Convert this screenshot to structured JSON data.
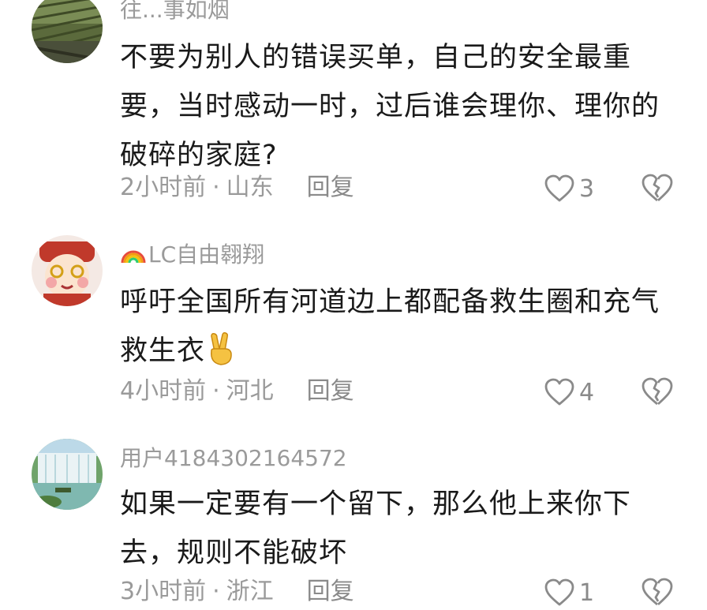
{
  "comments": [
    {
      "username": "往...事如烟",
      "text": "不要为别人的错误买单，自己的安全最重要，当时感动一时，过后谁会理你、理你的破碎的家庭?",
      "time": "2小时前",
      "location": "山东",
      "reply_label": "回复",
      "likes": "3",
      "avatar_icon": "field-photo-icon"
    },
    {
      "username": "LC自由翱翔",
      "text": "呼吁全国所有河道边上都配备救生圈和充气救生衣",
      "time": "4小时前",
      "location": "河北",
      "reply_label": "回复",
      "likes": "4",
      "avatar_icon": "cartoon-god-of-wealth-icon",
      "username_prefix_icon": "rainbow-icon",
      "text_suffix_icon": "victory-hand-emoji"
    },
    {
      "username": "用户4184302164572",
      "text": "如果一定要有一个留下，那么他上来你下去，规则不能破坏",
      "time": "3小时前",
      "location": "浙江",
      "reply_label": "回复",
      "likes": "1",
      "avatar_icon": "waterfall-photo-icon"
    }
  ],
  "meta_separator": "·",
  "colors": {
    "secondary_text": "#9a9a9a",
    "body_text": "#1a1a1a",
    "background": "#ffffff"
  }
}
